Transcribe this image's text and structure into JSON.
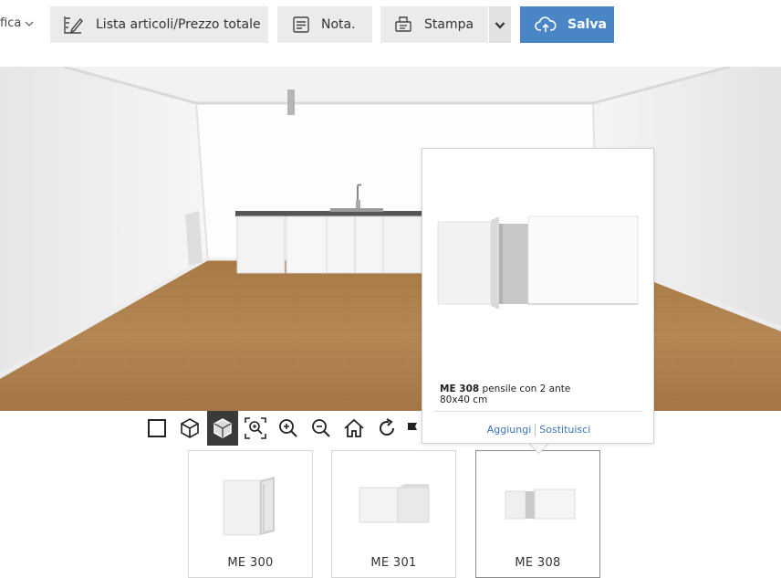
{
  "toolbar": {
    "modifica_label": "fica",
    "list_button": "Lista articoli/Prezzo totale",
    "note_button": "Nota.",
    "print_button": "Stampa",
    "save_button": "Salva",
    "accent_color": "#4a86c5"
  },
  "view_controls": {
    "items": [
      "2d-view-icon",
      "3d-wireframe-icon",
      "3d-solid-icon",
      "zoom-fit-icon",
      "zoom-in-icon",
      "zoom-out-icon",
      "home-icon",
      "rotate-icon",
      "flag-icon"
    ],
    "active": "3d-solid-icon"
  },
  "popup": {
    "code": "ME 308",
    "description": "pensile con 2 ante",
    "dimensions": "80x40 cm",
    "add_action": "Aggiungi",
    "replace_action": "Sostituisci"
  },
  "products": [
    {
      "name": "ME 300"
    },
    {
      "name": "ME 301"
    },
    {
      "name": "ME 308"
    }
  ],
  "selected_product": "ME 308"
}
